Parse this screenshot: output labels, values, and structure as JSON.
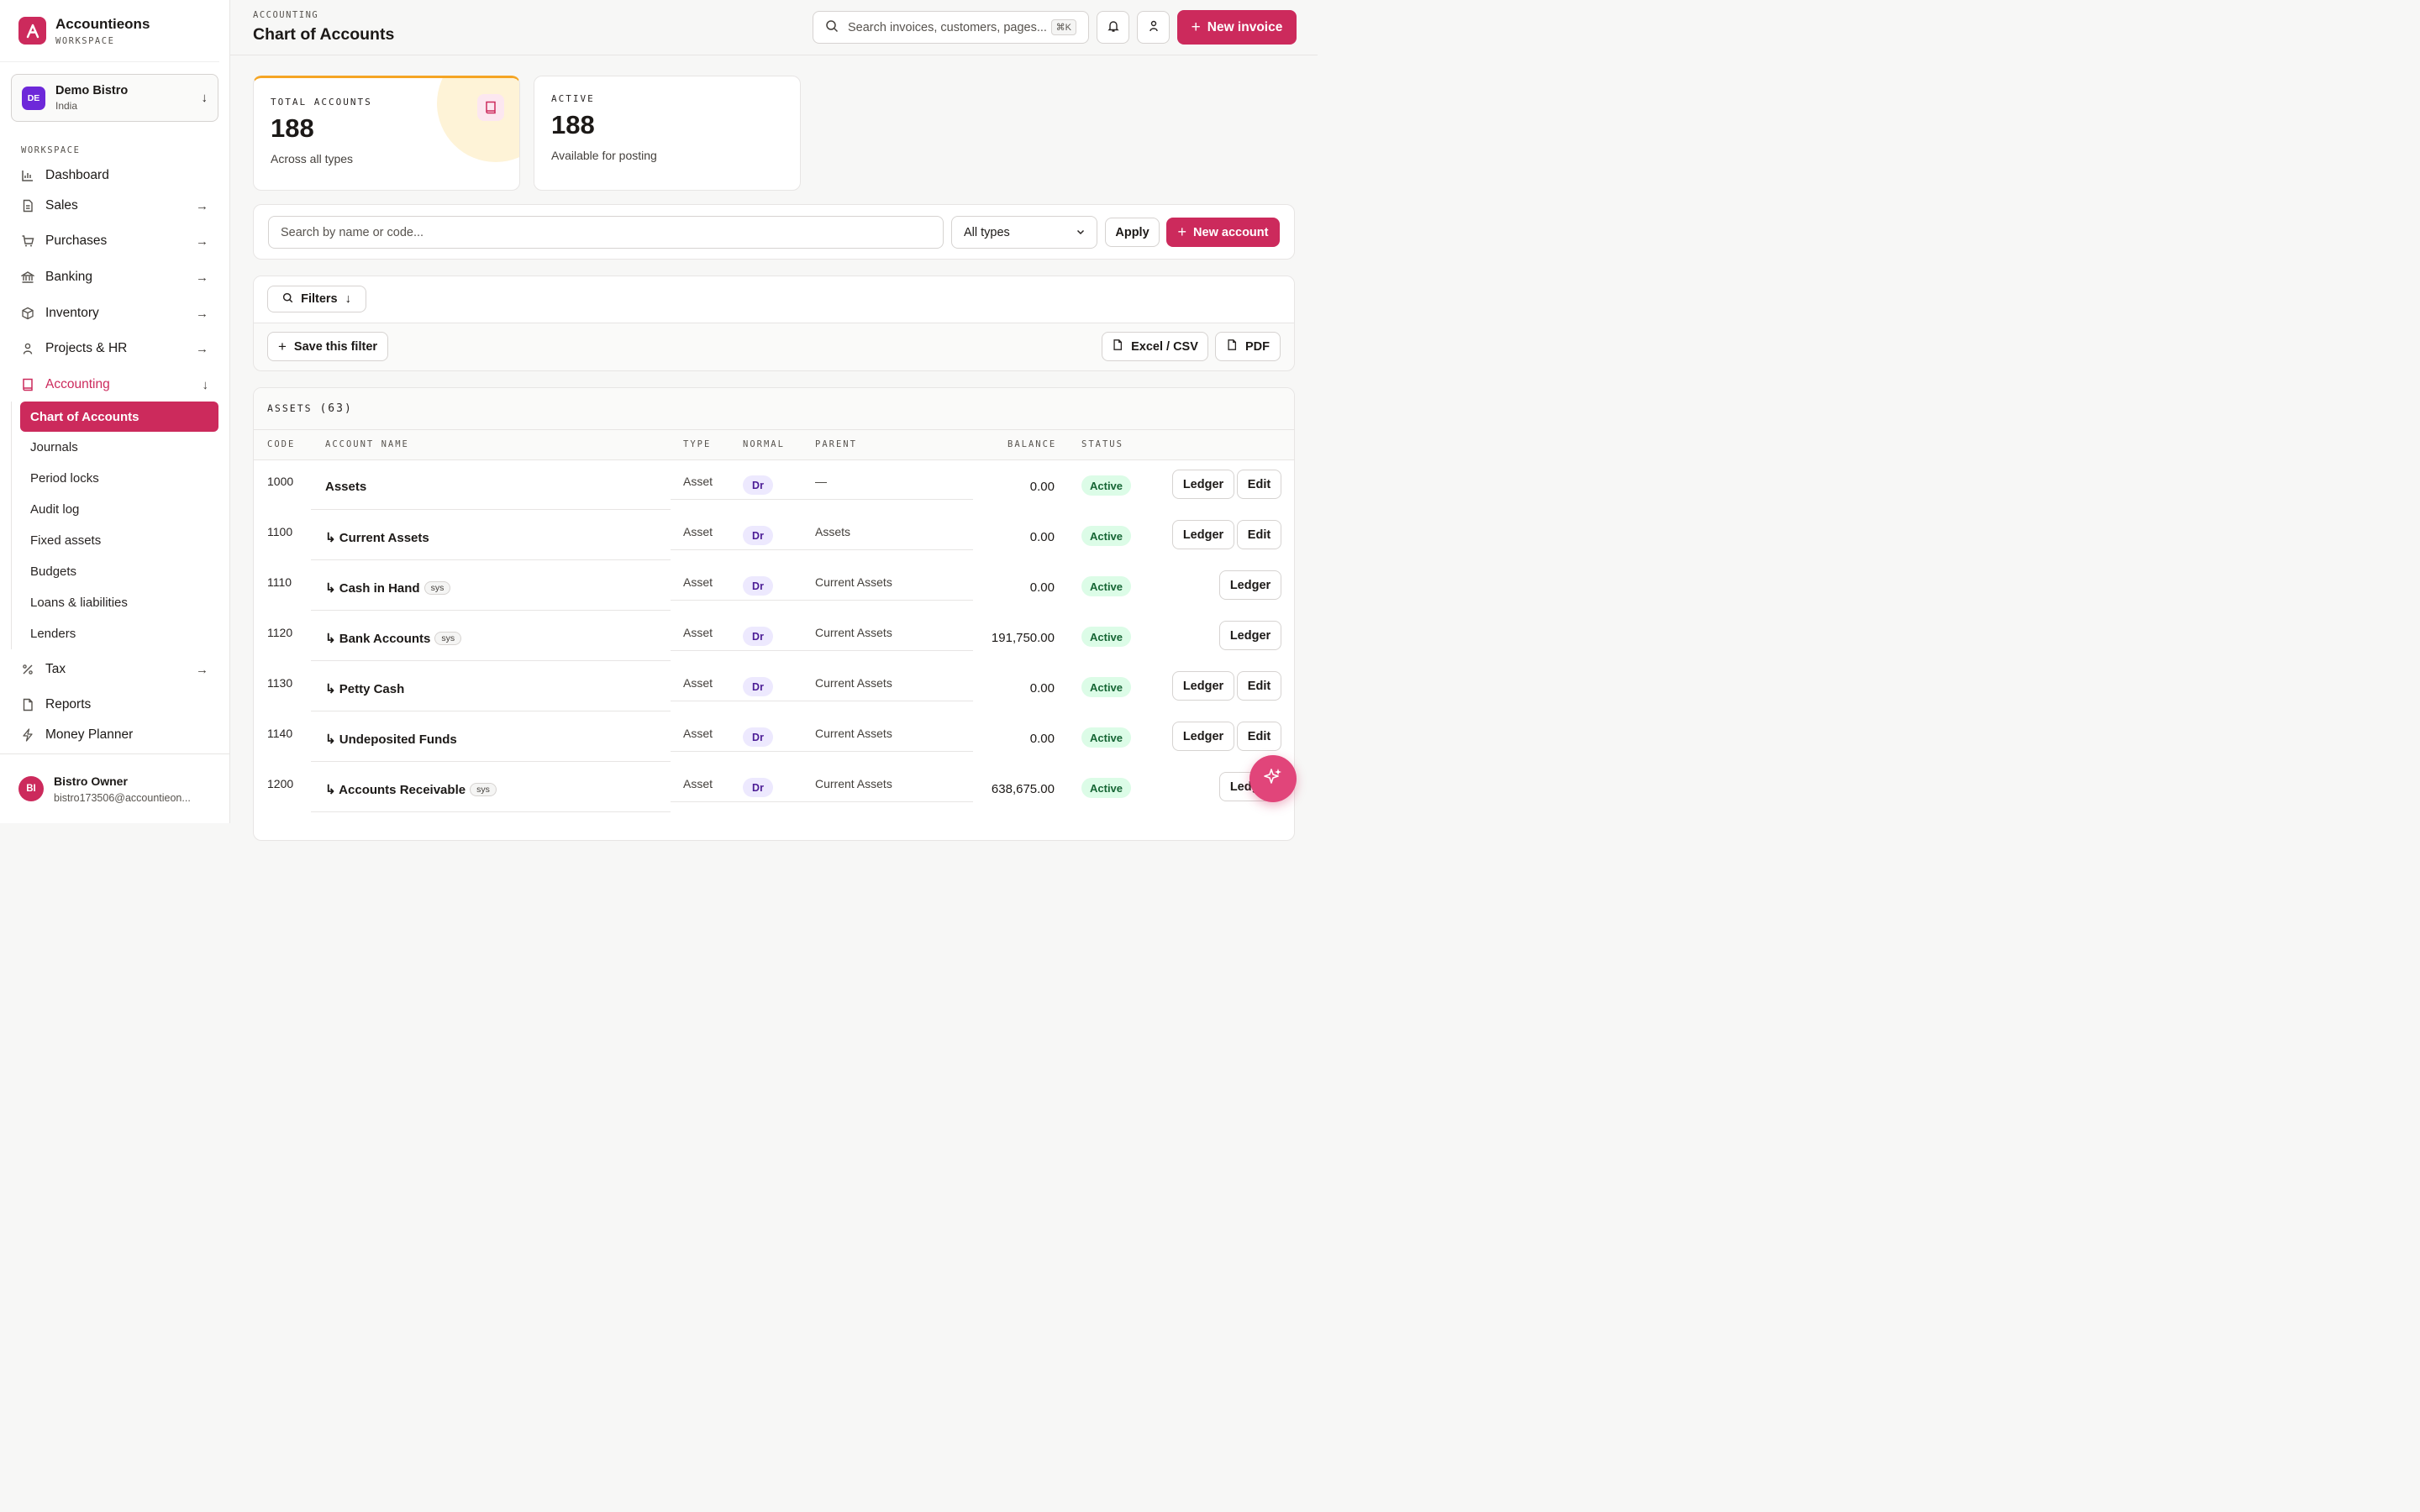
{
  "brand": {
    "name": "Accountieons",
    "sub": "WORKSPACE"
  },
  "org": {
    "badge": "DE",
    "name": "Demo Bistro",
    "country": "India"
  },
  "sidebar": {
    "section_label": "WORKSPACE",
    "items": [
      {
        "label": "Dashboard",
        "icon": "chart-icon"
      },
      {
        "label": "Sales",
        "icon": "document-icon"
      },
      {
        "label": "Purchases",
        "icon": "cart-icon"
      },
      {
        "label": "Banking",
        "icon": "bank-icon"
      },
      {
        "label": "Inventory",
        "icon": "box-icon"
      },
      {
        "label": "Projects & HR",
        "icon": "person-icon"
      },
      {
        "label": "Accounting",
        "icon": "book-icon"
      },
      {
        "label": "Tax",
        "icon": "percent-icon"
      },
      {
        "label": "Reports",
        "icon": "file-icon"
      },
      {
        "label": "Money Planner",
        "icon": "bolt-icon"
      }
    ],
    "sub_items": [
      "Chart of Accounts",
      "Journals",
      "Period locks",
      "Audit log",
      "Fixed assets",
      "Budgets",
      "Loans & liabilities",
      "Lenders"
    ]
  },
  "user": {
    "initials": "BI",
    "name": "Bistro Owner",
    "email": "bistro173506@accountieon..."
  },
  "header": {
    "crumb": "ACCOUNTING",
    "title": "Chart of Accounts",
    "search_placeholder": "Search invoices, customers, pages...",
    "shortcut": "⌘K",
    "new_invoice": "New invoice"
  },
  "stats": [
    {
      "label": "TOTAL ACCOUNTS",
      "value": "188",
      "sub": "Across all types"
    },
    {
      "label": "ACTIVE",
      "value": "188",
      "sub": "Available for posting"
    }
  ],
  "search": {
    "placeholder": "Search by name or code...",
    "type_select": "All types",
    "apply": "Apply",
    "new_account": "New account"
  },
  "filters": {
    "filters_label": "Filters",
    "save_filter": "Save this filter",
    "excel": "Excel / CSV",
    "pdf": "PDF"
  },
  "table": {
    "group_label": "ASSETS",
    "group_count": "(63)",
    "headers": [
      "CODE",
      "ACCOUNT NAME",
      "TYPE",
      "NORMAL",
      "PARENT",
      "BALANCE",
      "STATUS"
    ],
    "rows": [
      {
        "code": "1000",
        "name": "Assets",
        "type": "Asset",
        "normal": "Dr",
        "parent": "—",
        "balance": "0.00",
        "status": "Active",
        "sys": "",
        "ledger": "Ledger",
        "edit": "Edit"
      },
      {
        "code": "1100",
        "name": "↳ Current Assets",
        "type": "Asset",
        "normal": "Dr",
        "parent": "Assets",
        "balance": "0.00",
        "status": "Active",
        "sys": "",
        "ledger": "Ledger",
        "edit": "Edit"
      },
      {
        "code": "1110",
        "name": "↳ Cash in Hand",
        "type": "Asset",
        "normal": "Dr",
        "parent": "Current Assets",
        "balance": "0.00",
        "status": "Active",
        "sys": "sys",
        "ledger": "Ledger",
        "edit": ""
      },
      {
        "code": "1120",
        "name": "↳ Bank Accounts",
        "type": "Asset",
        "normal": "Dr",
        "parent": "Current Assets",
        "balance": "191,750.00",
        "status": "Active",
        "sys": "sys",
        "ledger": "Ledger",
        "edit": ""
      },
      {
        "code": "1130",
        "name": "↳ Petty Cash",
        "type": "Asset",
        "normal": "Dr",
        "parent": "Current Assets",
        "balance": "0.00",
        "status": "Active",
        "sys": "",
        "ledger": "Ledger",
        "edit": "Edit"
      },
      {
        "code": "1140",
        "name": "↳ Undeposited Funds",
        "type": "Asset",
        "normal": "Dr",
        "parent": "Current Assets",
        "balance": "0.00",
        "status": "Active",
        "sys": "",
        "ledger": "Ledger",
        "edit": "Edit"
      },
      {
        "code": "1200",
        "name": "↳ Accounts Receivable",
        "type": "Asset",
        "normal": "Dr",
        "parent": "Current Assets",
        "balance": "638,675.00",
        "status": "Active",
        "sys": "sys",
        "ledger": "Ledger",
        "edit": ""
      }
    ]
  },
  "colors": {
    "accent": "#cc2a5c",
    "status_active_bg": "#dcfce7",
    "status_active_fg": "#166534",
    "normal_bg": "#ede9fe"
  }
}
